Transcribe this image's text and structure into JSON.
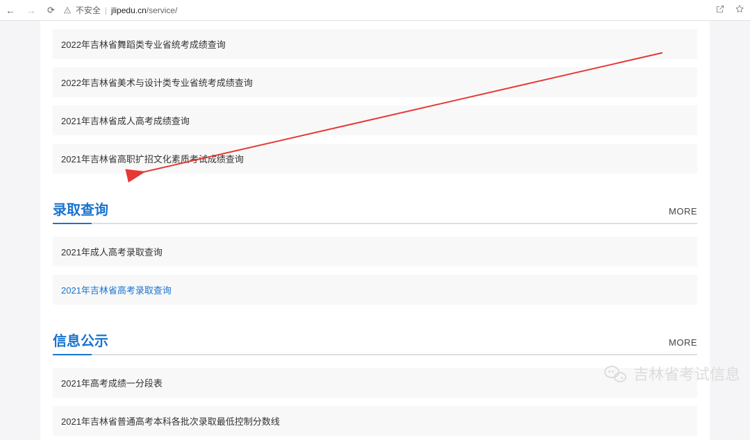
{
  "browser": {
    "not_secure_label": "不安全",
    "url_host": "jlipedu.cn",
    "url_path": "/service/"
  },
  "sections": {
    "score": {
      "items": [
        "2022年吉林省舞蹈类专业省统考成绩查询",
        "2022年吉林省美术与设计类专业省统考成绩查询",
        "2021年吉林省成人高考成绩查询",
        "2021年吉林省高职扩招文化素质考试成绩查询"
      ]
    },
    "admission": {
      "title": "录取查询",
      "more": "MORE",
      "items": [
        "2021年成人高考录取查询",
        "2021年吉林省高考录取查询"
      ]
    },
    "info": {
      "title": "信息公示",
      "more": "MORE",
      "items": [
        "2021年高考成绩一分段表",
        "2021年吉林省普通高考本科各批次录取最低控制分数线"
      ]
    }
  },
  "watermark": {
    "text": "吉林省考试信息"
  }
}
